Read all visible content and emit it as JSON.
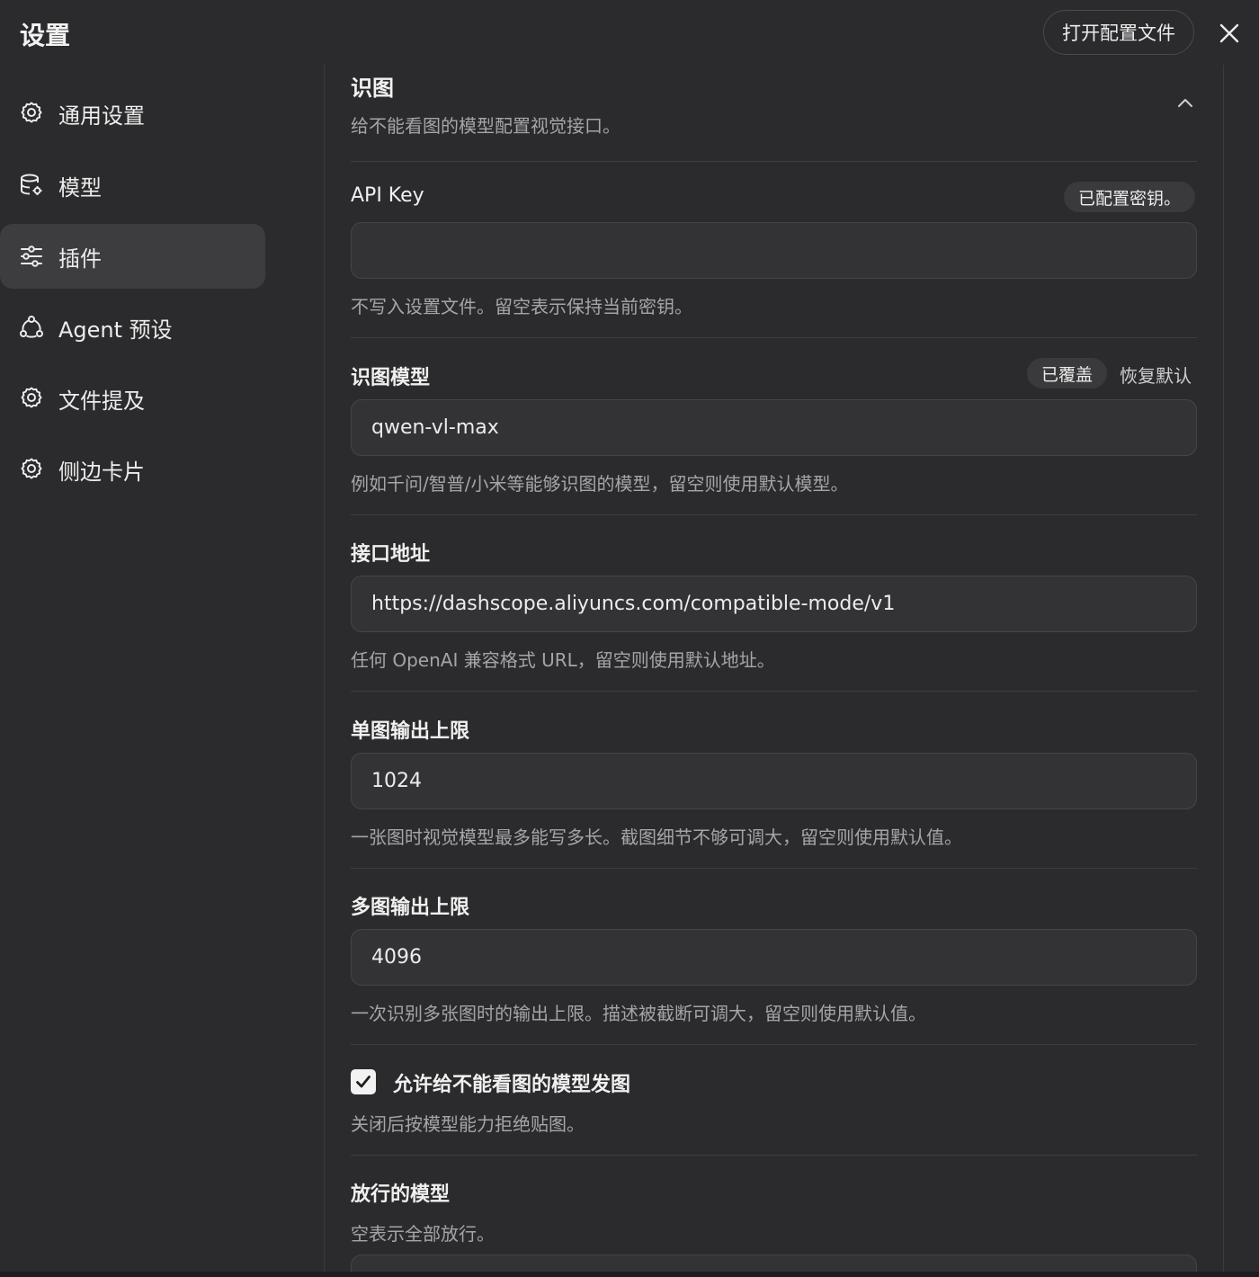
{
  "header": {
    "title": "设置",
    "open_config_label": "打开配置文件"
  },
  "sidebar": {
    "items": [
      {
        "label": "通用设置",
        "icon": "gear-icon",
        "active": false
      },
      {
        "label": "模型",
        "icon": "database-gear-icon",
        "active": false
      },
      {
        "label": "插件",
        "icon": "sliders-icon",
        "active": true
      },
      {
        "label": "Agent 预设",
        "icon": "agent-cycle-icon",
        "active": false
      },
      {
        "label": "文件提及",
        "icon": "gear-icon",
        "active": false
      },
      {
        "label": "侧边卡片",
        "icon": "gear-icon",
        "active": false
      }
    ]
  },
  "section": {
    "title": "识图",
    "description": "给不能看图的模型配置视觉接口。"
  },
  "fields": {
    "api_key": {
      "label": "API Key",
      "badge": "已配置密钥。",
      "value": "",
      "hint": "不写入设置文件。留空表示保持当前密钥。"
    },
    "vision_model": {
      "label": "识图模型",
      "badge": "已覆盖",
      "reset_label": "恢复默认",
      "value": "qwen-vl-max",
      "hint": "例如千问/智普/小米等能够识图的模型，留空则使用默认模型。"
    },
    "endpoint": {
      "label": "接口地址",
      "value": "https://dashscope.aliyuncs.com/compatible-mode/v1",
      "hint": "任何 OpenAI 兼容格式 URL，留空则使用默认地址。"
    },
    "single_limit": {
      "label": "单图输出上限",
      "value": "1024",
      "hint": "一张图时视觉模型最多能写多长。截图细节不够可调大，留空则使用默认值。"
    },
    "multi_limit": {
      "label": "多图输出上限",
      "value": "4096",
      "hint": "一次识别多张图时的输出上限。描述被截断可调大，留空则使用默认值。"
    },
    "allow_images": {
      "label": "允许给不能看图的模型发图",
      "checked": true,
      "hint": "关闭后按模型能力拒绝贴图。"
    },
    "allowed_models": {
      "label": "放行的模型",
      "hint": "空表示全部放行。"
    }
  }
}
